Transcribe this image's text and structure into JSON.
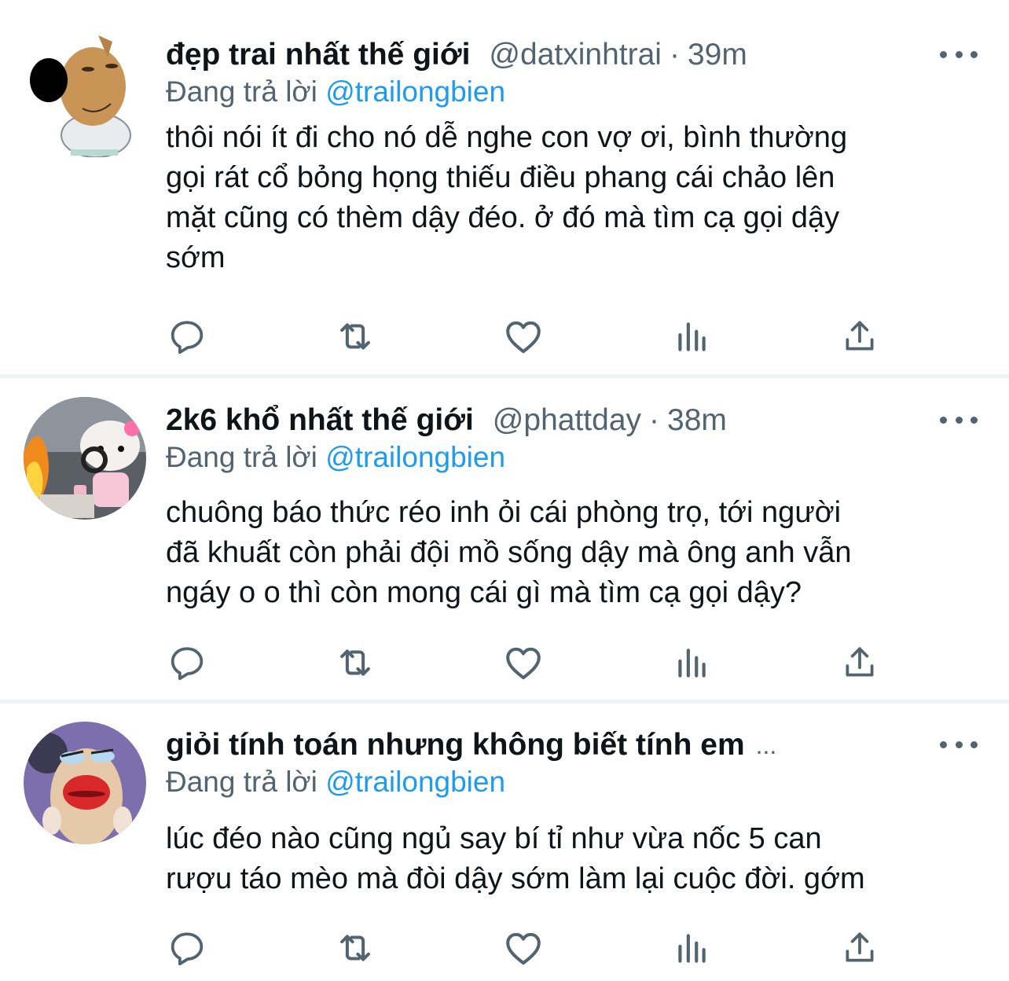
{
  "tweets": [
    {
      "name": "đẹp trai nhất thế giới",
      "handle": "@datxinhtrai",
      "sep": "·",
      "time": "39m",
      "replying_prefix": "Đang trả lời ",
      "replying_to": "@trailongbien",
      "lines": [
        "thôi nói ít đi cho nó dễ nghe con vợ ơi, bình thường",
        "gọi rát cổ bỏng họng thiếu điều phang cái chảo lên",
        "mặt cũng có thèm dậy đéo. ở đó mà tìm cạ gọi dậy",
        "sớm"
      ]
    },
    {
      "name": "2k6 khổ nhất thế giới",
      "handle": "@phattday",
      "sep": "·",
      "time": "38m",
      "replying_prefix": "Đang trả lời ",
      "replying_to": "@trailongbien",
      "lines": [
        "chuông báo thức réo inh ỏi cái phòng trọ, tới người",
        "đã khuất còn phải đội mồ sống dậy mà ông anh vẫn",
        "ngáy o o thì còn mong cái gì mà tìm cạ gọi dậy?"
      ]
    },
    {
      "name": "giỏi tính toán nhưng không biết tính em",
      "name_ellipsis": "...",
      "replying_prefix": "Đang trả lời ",
      "replying_to": "@trailongbien",
      "lines": [
        "lúc đéo nào cũng ngủ say bí tỉ như vừa nốc 5 can",
        "rượu táo mèo mà đòi dậy sớm làm lại cuộc đời. gớm"
      ]
    }
  ],
  "colors": {
    "text": "#0f1419",
    "secondary": "#536471",
    "link": "#1d9bf0",
    "divider": "#eff3f4"
  },
  "icons": [
    "reply-icon",
    "retweet-icon",
    "like-icon",
    "analytics-icon",
    "share-icon",
    "more-icon"
  ]
}
